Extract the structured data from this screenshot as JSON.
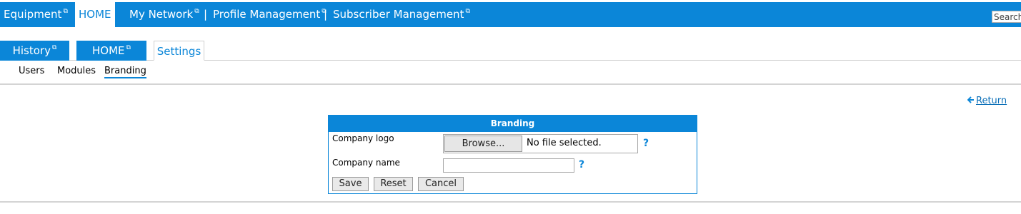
{
  "topnav": {
    "items": [
      {
        "label": "Equipment",
        "external": true
      },
      {
        "label": "HOME",
        "external": false,
        "active": true
      },
      {
        "label": "My Network",
        "external": true
      },
      {
        "label": "Profile Management",
        "external": true
      },
      {
        "label": "Subscriber Management",
        "external": true
      }
    ],
    "separator": "|",
    "search_placeholder": "Search"
  },
  "tabs": [
    {
      "label": "History",
      "external": true
    },
    {
      "label": "HOME",
      "external": true
    },
    {
      "label": "Settings",
      "selected": true
    }
  ],
  "subnav": [
    {
      "label": "Users"
    },
    {
      "label": "Modules"
    },
    {
      "label": "Branding",
      "active": true
    }
  ],
  "return_link": {
    "label": "Return",
    "icon": "arrow-left-icon"
  },
  "branding_form": {
    "title": "Branding",
    "logo_label": "Company logo",
    "browse_label": "Browse...",
    "file_status": "No file selected.",
    "name_label": "Company name",
    "name_value": "",
    "help_glyph": "?",
    "buttons": {
      "save": "Save",
      "reset": "Reset",
      "cancel": "Cancel"
    }
  },
  "colors": {
    "accent": "#0b86d8",
    "link": "#0b6fb8",
    "divider": "#d4d4d4"
  },
  "external_icon": "⧉"
}
